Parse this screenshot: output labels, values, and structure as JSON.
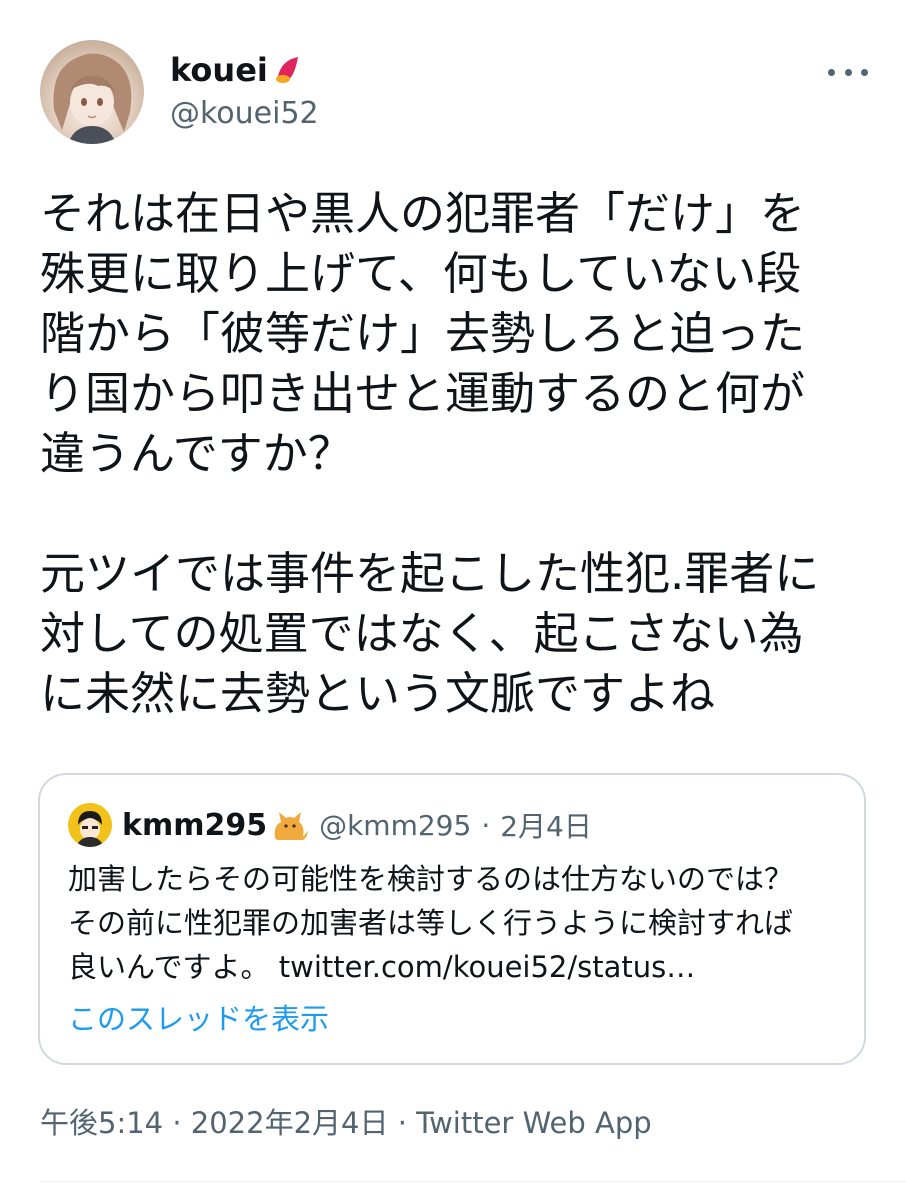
{
  "author": {
    "display_name": "kouei",
    "handle": "@kouei52",
    "name_emoji": "crescent-moon-emoji"
  },
  "tweet": {
    "text": "それは在日や黒人の犯罪者「だけ」を\n殊更に取り上げて、何もしていない段\n階から「彼等だけ」去勢しろと迫った\nり国から叩き出せと運動するのと何が\n違うんですか？\n\n元ツイでは事件を起こした性犯.罪者に\n対しての処置ではなく、起こさない為\nに未然に去勢という文脈ですよね"
  },
  "quote": {
    "display_name": "kmm295",
    "name_emoji": "cat-emoji",
    "handle": "@kmm295",
    "separator": "·",
    "date": "2月4日",
    "text": "加害したらその可能性を検討するのは仕方ないのでは？\nその前に性犯罪の加害者は等しく行うように検討すれば\n良いんですよ。 ",
    "link": "twitter.com/kouei52/status…",
    "show_thread": "このスレッドを表示"
  },
  "meta": {
    "time": "午後5:14",
    "sep1": " · ",
    "date": "2022年2月4日",
    "sep2": " · ",
    "client": "Twitter Web App"
  },
  "colors": {
    "text": "#0f1419",
    "secondary": "#536471",
    "link": "#1d9bf0",
    "border": "#cfd9de"
  }
}
